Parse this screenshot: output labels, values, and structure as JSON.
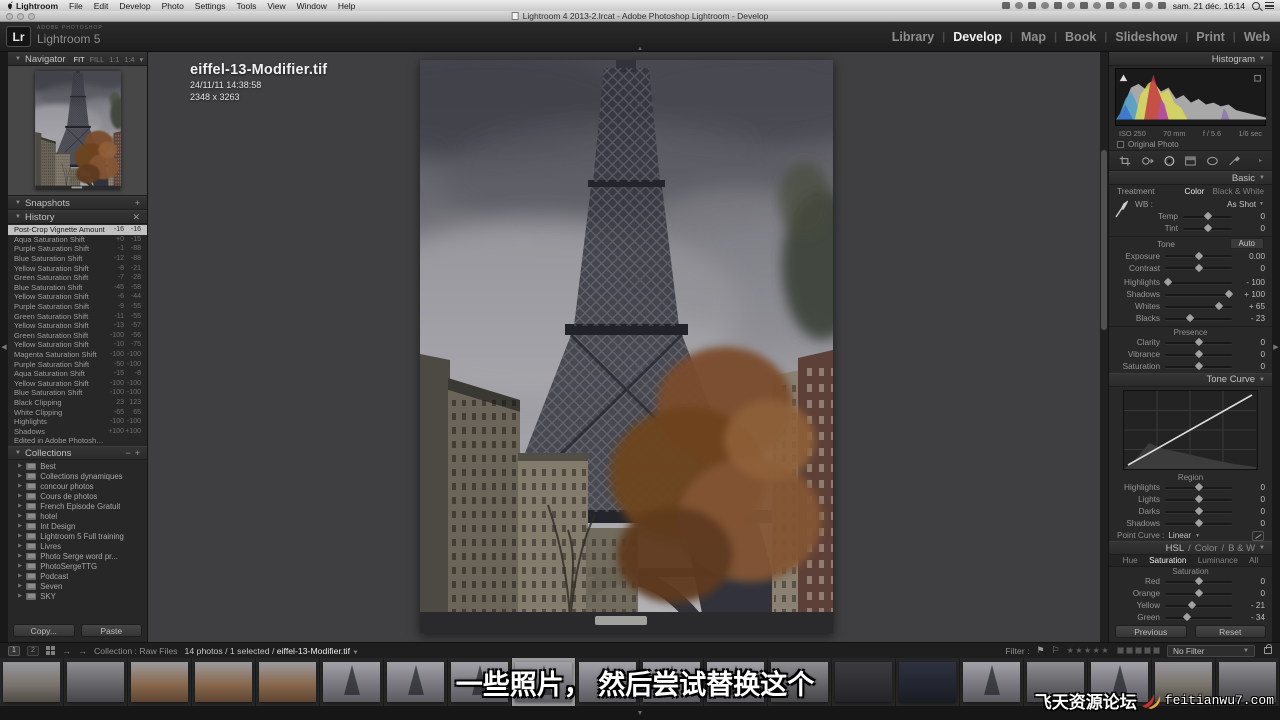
{
  "menubar": {
    "menus": [
      "Lightroom",
      "File",
      "Edit",
      "Develop",
      "Photo",
      "Settings",
      "Tools",
      "View",
      "Window",
      "Help"
    ],
    "clock": "sam. 21 déc. 16:14",
    "status_icon_count": 13
  },
  "titlebar": {
    "title": "Lightroom 4 2013-2.lrcat - Adobe Photoshop Lightroom - Develop"
  },
  "header": {
    "logo": "Lr",
    "app_sub": "ADOBE PHOTOSHOP",
    "app_name": "Lightroom 5",
    "modules": [
      {
        "label": "Library",
        "active": false
      },
      {
        "label": "Develop",
        "active": true
      },
      {
        "label": "Map",
        "active": false
      },
      {
        "label": "Book",
        "active": false
      },
      {
        "label": "Slideshow",
        "active": false
      },
      {
        "label": "Print",
        "active": false
      },
      {
        "label": "Web",
        "active": false
      }
    ]
  },
  "left_panel": {
    "navigator_title": "Navigator",
    "navigator_zoom": [
      "FIT",
      "FILL",
      "1:1",
      "1:4"
    ],
    "snapshots_title": "Snapshots",
    "history_title": "History",
    "history": [
      {
        "name": "Post-Crop Vignette Amount",
        "v1": "-16",
        "v2": "-16",
        "selected": true
      },
      {
        "name": "Aqua Saturation Shift",
        "v1": "+0",
        "v2": "-15",
        "selected": false
      },
      {
        "name": "Purple Saturation Shift",
        "v1": "-1",
        "v2": "-88",
        "selected": false
      },
      {
        "name": "Blue Saturation Shift",
        "v1": "-12",
        "v2": "-88",
        "selected": false
      },
      {
        "name": "Yellow Saturation Shift",
        "v1": "-8",
        "v2": "-21",
        "selected": false
      },
      {
        "name": "Green Saturation Shift",
        "v1": "-7",
        "v2": "-28",
        "selected": false
      },
      {
        "name": "Blue Saturation Shift",
        "v1": "-45",
        "v2": "-58",
        "selected": false
      },
      {
        "name": "Yellow Saturation Shift",
        "v1": "-6",
        "v2": "-44",
        "selected": false
      },
      {
        "name": "Purple Saturation Shift",
        "v1": "-9",
        "v2": "-55",
        "selected": false
      },
      {
        "name": "Green Saturation Shift",
        "v1": "-11",
        "v2": "-55",
        "selected": false
      },
      {
        "name": "Yellow Saturation Shift",
        "v1": "-13",
        "v2": "-57",
        "selected": false
      },
      {
        "name": "Green Saturation Shift",
        "v1": "-100",
        "v2": "-56",
        "selected": false
      },
      {
        "name": "Yellow Saturation Shift",
        "v1": "-10",
        "v2": "-75",
        "selected": false
      },
      {
        "name": "Magenta Saturation Shift",
        "v1": "-100",
        "v2": "-100",
        "selected": false
      },
      {
        "name": "Purple Saturation Shift",
        "v1": "-50",
        "v2": "-100",
        "selected": false
      },
      {
        "name": "Aqua Saturation Shift",
        "v1": "-15",
        "v2": "-8",
        "selected": false
      },
      {
        "name": "Yellow Saturation Shift",
        "v1": "-100",
        "v2": "-100",
        "selected": false
      },
      {
        "name": "Blue Saturation Shift",
        "v1": "-100",
        "v2": "-100",
        "selected": false
      },
      {
        "name": "Black Clipping",
        "v1": "23",
        "v2": "123",
        "selected": false
      },
      {
        "name": "White Clipping",
        "v1": "-65",
        "v2": "65",
        "selected": false
      },
      {
        "name": "Highlights",
        "v1": "-100",
        "v2": "-100",
        "selected": false
      },
      {
        "name": "Shadows",
        "v1": "+100",
        "v2": "+100",
        "selected": false
      },
      {
        "name": "Edited in Adobe Photoshop (21/12/...",
        "v1": "",
        "v2": "",
        "selected": false
      }
    ],
    "collections_title": "Collections",
    "collections": [
      "Best",
      "Collections dynamiques",
      "concour photos",
      "Cours de photos",
      "French Episode Gratuit",
      "hotel",
      "Int Design",
      "Lightroom 5 Full training",
      "Livres",
      "Photo Serge word pr...",
      "PhotoSergeTTG",
      "Podcast",
      "Seven",
      "SKY"
    ],
    "copy_label": "Copy...",
    "paste_label": "Paste"
  },
  "photo_info": {
    "filename": "eiffel-13-Modifier.tif",
    "datetime": "24/11/11 14:38:58",
    "dimensions": "2348 x 3263"
  },
  "right_panel": {
    "histogram_title": "Histogram",
    "histogram_iso": "ISO 250",
    "histogram_focal": "70 mm",
    "histogram_aperture": "f / 5.6",
    "histogram_shutter": "1/6 sec",
    "original_photo_label": "Original Photo",
    "basic": {
      "title": "Basic",
      "treatment_label": "Treatment",
      "color_label": "Color",
      "bw_label": "Black & White",
      "wb_label": "WB :",
      "wb_value": "As Shot",
      "tone_label": "Tone",
      "auto_label": "Auto",
      "sliders_wb": [
        {
          "label": "Temp",
          "value": "0",
          "pos": 50
        },
        {
          "label": "Tint",
          "value": "0",
          "pos": 50
        }
      ],
      "sliders_tone": [
        {
          "label": "Exposure",
          "value": "0.00",
          "pos": 50
        },
        {
          "label": "Contrast",
          "value": "0",
          "pos": 50
        },
        {
          "label": "Highlights",
          "value": "- 100",
          "pos": 4
        },
        {
          "label": "Shadows",
          "value": "+ 100",
          "pos": 96
        },
        {
          "label": "Whites",
          "value": "+ 65",
          "pos": 80
        },
        {
          "label": "Blacks",
          "value": "- 23",
          "pos": 38
        }
      ],
      "presence_label": "Presence",
      "sliders_presence": [
        {
          "label": "Clarity",
          "value": "0",
          "pos": 50
        },
        {
          "label": "Vibrance",
          "value": "0",
          "pos": 50
        },
        {
          "label": "Saturation",
          "value": "0",
          "pos": 50
        }
      ]
    },
    "tone_curve": {
      "title": "Tone Curve",
      "region_label": "Region",
      "sliders": [
        {
          "label": "Highlights",
          "value": "0",
          "pos": 50
        },
        {
          "label": "Lights",
          "value": "0",
          "pos": 50
        },
        {
          "label": "Darks",
          "value": "0",
          "pos": 50
        },
        {
          "label": "Shadows",
          "value": "0",
          "pos": 50
        }
      ],
      "point_curve_label": "Point Curve :",
      "point_curve_value": "Linear"
    },
    "hsl": {
      "title_hsl": "HSL",
      "title_color": "Color",
      "title_bw": "B & W",
      "tabs": [
        {
          "label": "Hue",
          "active": false
        },
        {
          "label": "Saturation",
          "active": true
        },
        {
          "label": "Luminance",
          "active": false
        },
        {
          "label": "All",
          "active": false
        }
      ],
      "section_label": "Saturation",
      "sliders": [
        {
          "label": "Red",
          "value": "0",
          "pos": 50
        },
        {
          "label": "Orange",
          "value": "0",
          "pos": 50
        },
        {
          "label": "Yellow",
          "value": "- 21",
          "pos": 40
        },
        {
          "label": "Green",
          "value": "- 34",
          "pos": 33
        }
      ]
    },
    "previous_label": "Previous",
    "reset_label": "Reset"
  },
  "toolbar": {
    "monitor1": "1",
    "monitor2": "2",
    "collection_label": "Collection : Raw Files",
    "status": "14 photos / 1 selected /",
    "status_file": "eiffel-13-Modifier.tif",
    "filter_label": "Filter :",
    "no_filter_label": "No Filter"
  },
  "filmstrip": {
    "selected_index": 8,
    "variants": [
      "street",
      "city",
      "autumn",
      "autumn",
      "autumn",
      "tower",
      "tower",
      "tower",
      "tower",
      "tower",
      "tower",
      "tower",
      "city",
      "dark",
      "night",
      "tower",
      "city",
      "tower",
      "street",
      "city"
    ]
  },
  "subtitle": "一些照片， 然后尝试替换这个",
  "watermark": {
    "site_name": "飞天资源论坛",
    "site_url": "feitianwu7.com"
  },
  "colors": {
    "selection_bg": "#c2c2c2",
    "module_active": "#f2f2f2",
    "module_inactive": "#8f8f8f",
    "canvas_bg": "#3f3f41"
  }
}
